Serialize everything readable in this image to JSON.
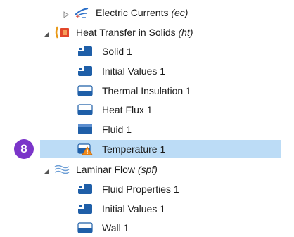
{
  "tree": {
    "electric_currents": {
      "label": "Electric Currents ",
      "tag": "(ec)",
      "icon": "electric-currents-icon",
      "expanded": false
    },
    "heat_transfer": {
      "label": "Heat Transfer in Solids ",
      "tag": "(ht)",
      "icon": "heat-transfer-icon",
      "expanded": true
    },
    "ht_children": [
      {
        "label": "Solid 1",
        "icon": "domain-node-icon"
      },
      {
        "label": "Initial Values 1",
        "icon": "domain-node-icon"
      },
      {
        "label": "Thermal Insulation 1",
        "icon": "boundary-node-icon"
      },
      {
        "label": "Heat Flux 1",
        "icon": "boundary-node-icon"
      },
      {
        "label": "Fluid 1",
        "icon": "domain-node-icon"
      },
      {
        "label": "Temperature 1",
        "icon": "boundary-warning-icon",
        "selected": true
      }
    ],
    "laminar_flow": {
      "label": "Laminar Flow ",
      "tag": "(spf)",
      "icon": "laminar-flow-icon",
      "expanded": true
    },
    "lf_children": [
      {
        "label": "Fluid Properties 1",
        "icon": "domain-node-icon"
      },
      {
        "label": "Initial Values 1",
        "icon": "domain-node-icon"
      },
      {
        "label": "Wall 1",
        "icon": "boundary-node-icon"
      }
    ]
  },
  "callout": {
    "number": "8",
    "color": "#7b35c9"
  },
  "colors": {
    "selection": "#bcdcf6",
    "node_blue": "#1f5fa8"
  }
}
